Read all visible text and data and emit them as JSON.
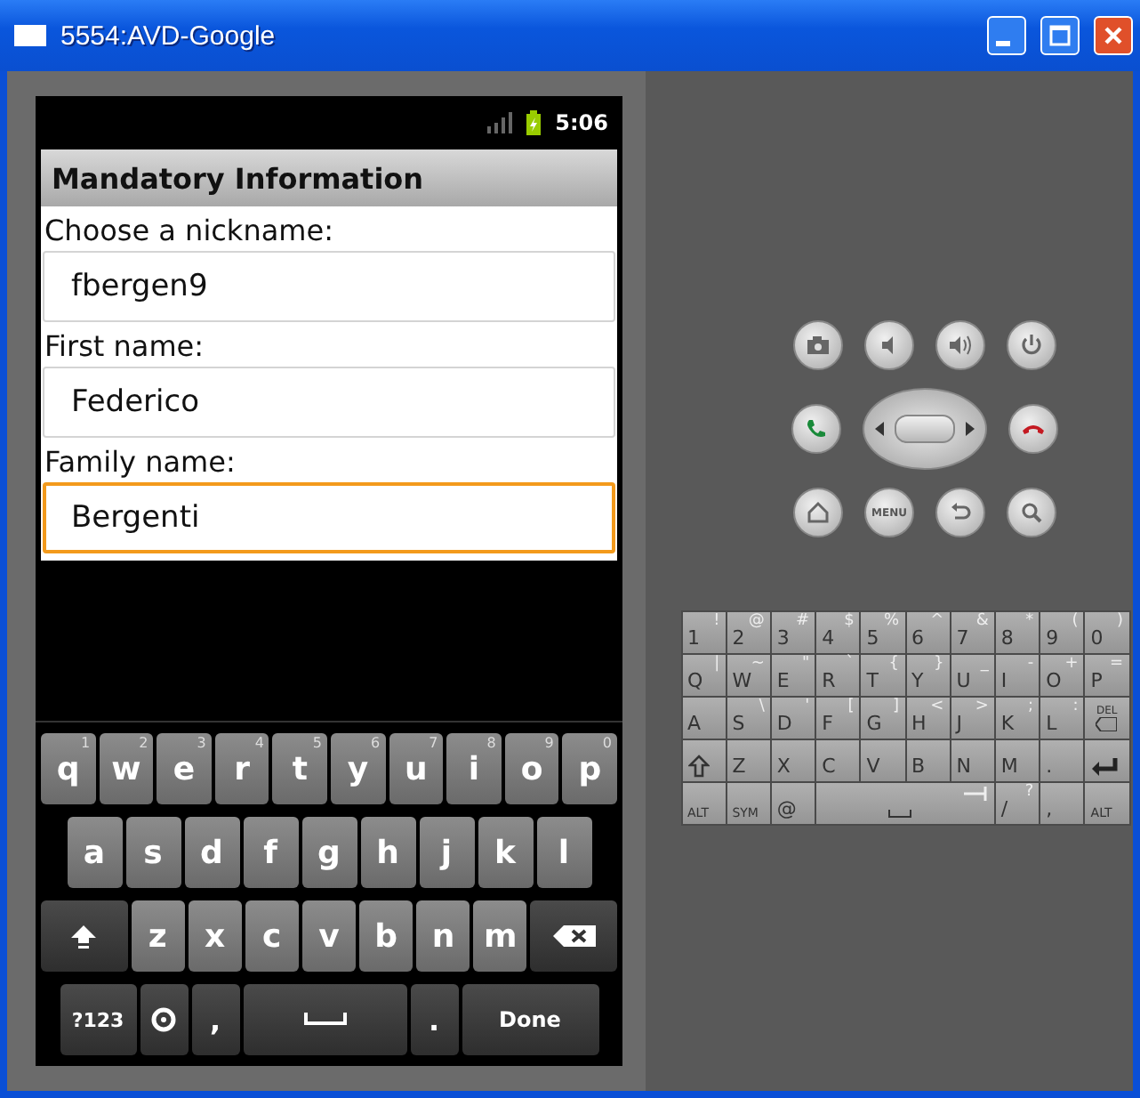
{
  "window": {
    "title": "5554:AVD-Google"
  },
  "status_bar": {
    "time": "5:06"
  },
  "screen": {
    "title": "Mandatory Information"
  },
  "fields": [
    {
      "label": "Choose a nickname:",
      "value": "fbergen9",
      "focused": false
    },
    {
      "label": "First name:",
      "value": "Federico",
      "focused": false
    },
    {
      "label": "Family name:",
      "value": "Bergenti",
      "focused": true
    }
  ],
  "soft_keyboard": [
    [
      {
        "kind": "letter",
        "label": "q",
        "hint": "1"
      },
      {
        "kind": "letter",
        "label": "w",
        "hint": "2"
      },
      {
        "kind": "letter",
        "label": "e",
        "hint": "3"
      },
      {
        "kind": "letter",
        "label": "r",
        "hint": "4"
      },
      {
        "kind": "letter",
        "label": "t",
        "hint": "5"
      },
      {
        "kind": "letter",
        "label": "y",
        "hint": "6"
      },
      {
        "kind": "letter",
        "label": "u",
        "hint": "7"
      },
      {
        "kind": "letter",
        "label": "i",
        "hint": "8"
      },
      {
        "kind": "letter",
        "label": "o",
        "hint": "9"
      },
      {
        "kind": "letter",
        "label": "p",
        "hint": "0"
      }
    ],
    [
      {
        "kind": "letter",
        "label": "a"
      },
      {
        "kind": "letter",
        "label": "s"
      },
      {
        "kind": "letter",
        "label": "d"
      },
      {
        "kind": "letter",
        "label": "f"
      },
      {
        "kind": "letter",
        "label": "g"
      },
      {
        "kind": "letter",
        "label": "h"
      },
      {
        "kind": "letter",
        "label": "j"
      },
      {
        "kind": "letter",
        "label": "k"
      },
      {
        "kind": "letter",
        "label": "l"
      }
    ],
    [
      {
        "kind": "shift"
      },
      {
        "kind": "letter",
        "label": "z"
      },
      {
        "kind": "letter",
        "label": "x"
      },
      {
        "kind": "letter",
        "label": "c"
      },
      {
        "kind": "letter",
        "label": "v"
      },
      {
        "kind": "letter",
        "label": "b"
      },
      {
        "kind": "letter",
        "label": "n"
      },
      {
        "kind": "letter",
        "label": "m"
      },
      {
        "kind": "delete"
      }
    ],
    [
      {
        "kind": "text",
        "label": "?123"
      },
      {
        "kind": "settings"
      },
      {
        "kind": "text",
        "label": ","
      },
      {
        "kind": "space"
      },
      {
        "kind": "text",
        "label": "."
      },
      {
        "kind": "done",
        "label": "Done"
      }
    ]
  ],
  "hardware_buttons": [
    [
      {
        "kind": "camera"
      },
      {
        "kind": "volume-down"
      },
      {
        "kind": "volume-up"
      },
      {
        "kind": "power"
      }
    ],
    [
      {
        "kind": "call"
      },
      {
        "kind": "dpad"
      },
      {
        "kind": "end-call"
      }
    ],
    [
      {
        "kind": "home"
      },
      {
        "kind": "menu",
        "label": "MENU"
      },
      {
        "kind": "back"
      },
      {
        "kind": "search"
      }
    ]
  ],
  "hardware_keyboard": [
    [
      {
        "label": "1",
        "alt": "!"
      },
      {
        "label": "2",
        "alt": "@"
      },
      {
        "label": "3",
        "alt": "#"
      },
      {
        "label": "4",
        "alt": "$"
      },
      {
        "label": "5",
        "alt": "%"
      },
      {
        "label": "6",
        "alt": "^"
      },
      {
        "label": "7",
        "alt": "&"
      },
      {
        "label": "8",
        "alt": "*"
      },
      {
        "label": "9",
        "alt": "("
      },
      {
        "label": "0",
        "alt": ")"
      }
    ],
    [
      {
        "label": "Q",
        "alt": "|"
      },
      {
        "label": "W",
        "alt": "~"
      },
      {
        "label": "E",
        "alt": "\""
      },
      {
        "label": "R",
        "alt": "`"
      },
      {
        "label": "T",
        "alt": "{"
      },
      {
        "label": "Y",
        "alt": "}"
      },
      {
        "label": "U",
        "alt": "_"
      },
      {
        "label": "I",
        "alt": "-"
      },
      {
        "label": "O",
        "alt": "+"
      },
      {
        "label": "P",
        "alt": "="
      }
    ],
    [
      {
        "label": "A"
      },
      {
        "label": "S",
        "alt": "\\"
      },
      {
        "label": "D",
        "alt": "'"
      },
      {
        "label": "F",
        "alt": "["
      },
      {
        "label": "G",
        "alt": "]"
      },
      {
        "label": "H",
        "alt": "<"
      },
      {
        "label": "J",
        "alt": ">"
      },
      {
        "label": "K",
        "alt": ";"
      },
      {
        "label": "L",
        "alt": ":"
      },
      {
        "kind": "delete",
        "label": "DEL"
      }
    ],
    [
      {
        "kind": "shift"
      },
      {
        "label": "Z"
      },
      {
        "label": "X"
      },
      {
        "label": "C"
      },
      {
        "label": "V"
      },
      {
        "label": "B"
      },
      {
        "label": "N"
      },
      {
        "label": "M"
      },
      {
        "label": "."
      },
      {
        "kind": "enter"
      }
    ],
    [
      {
        "kind": "small",
        "label": "ALT"
      },
      {
        "kind": "small",
        "label": "SYM"
      },
      {
        "label": "@"
      },
      {
        "kind": "space"
      },
      {
        "label": "/",
        "alt": "?"
      },
      {
        "label": ","
      },
      {
        "kind": "small",
        "label": "ALT"
      }
    ]
  ]
}
